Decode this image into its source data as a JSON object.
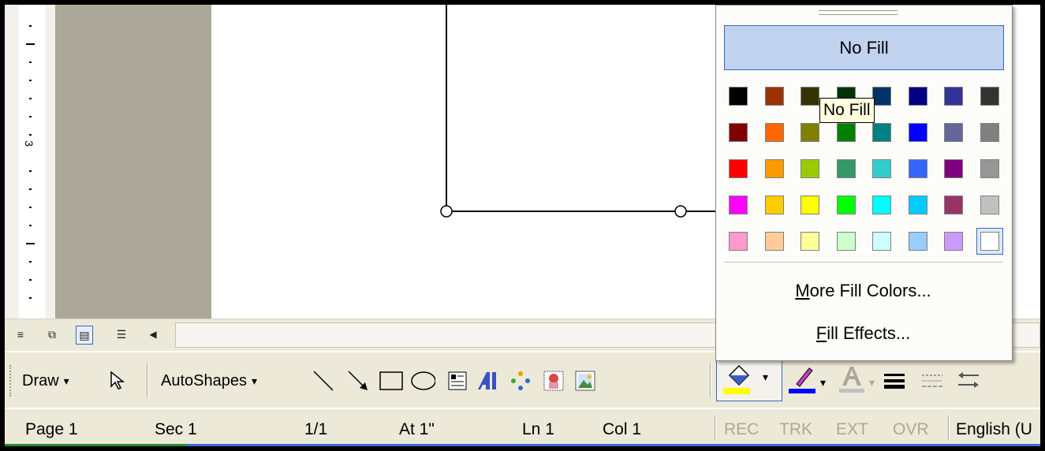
{
  "ruler": {
    "label": "3"
  },
  "viewbar": {
    "buttons": [
      {
        "name": "normal-view-button",
        "glyph": "≡"
      },
      {
        "name": "web-layout-view-button",
        "glyph": "⧉"
      },
      {
        "name": "print-layout-view-button",
        "glyph": "▤"
      },
      {
        "name": "outline-view-button",
        "glyph": "☰"
      },
      {
        "name": "scroll-left-button",
        "glyph": "◀"
      }
    ]
  },
  "drawing_toolbar": {
    "draw_label": "Draw",
    "autoshapes_label": "AutoShapes",
    "dropdown_glyph": "▾",
    "fill_color": "#ffff00",
    "line_color": "#0000ff",
    "font_color": "#c0c0c0",
    "icons": [
      "select-objects-icon",
      "line-icon",
      "arrow-icon",
      "rectangle-icon",
      "oval-icon",
      "text-box-icon",
      "wordart-icon",
      "diagram-icon",
      "clip-art-icon",
      "picture-icon",
      "fill-color-icon",
      "line-color-icon",
      "font-color-icon",
      "line-style-icon",
      "dash-style-icon",
      "arrow-style-icon"
    ]
  },
  "status": {
    "page": "Page 1",
    "sec": "Sec 1",
    "pages": "1/1",
    "at": "At 1\"",
    "ln": "Ln 1",
    "col": "Col 1",
    "rec": "REC",
    "trk": "TRK",
    "ext": "EXT",
    "ovr": "OVR",
    "language": "English (U"
  },
  "fill_popup": {
    "no_fill": "No Fill",
    "colors": [
      [
        "#000000",
        "#993300",
        "#333300",
        "#003300",
        "#003366",
        "#000080",
        "#333399",
        "#333333"
      ],
      [
        "#800000",
        "#ff6600",
        "#808000",
        "#008000",
        "#008080",
        "#0000ff",
        "#666699",
        "#808080"
      ],
      [
        "#ff0000",
        "#ff9900",
        "#99cc00",
        "#339966",
        "#33cccc",
        "#3366ff",
        "#800080",
        "#969696"
      ],
      [
        "#ff00ff",
        "#ffcc00",
        "#ffff00",
        "#00ff00",
        "#00ffff",
        "#00ccff",
        "#993366",
        "#c0c0c0"
      ],
      [
        "#ff99cc",
        "#ffcc99",
        "#ffff99",
        "#ccffcc",
        "#ccffff",
        "#99ccff",
        "#cc99ff",
        "#ffffff"
      ]
    ],
    "more_colors_prefix": "",
    "more_colors_key": "M",
    "more_colors_rest": "ore Fill Colors...",
    "fill_effects_key": "F",
    "fill_effects_rest": "ill Effects..."
  },
  "tooltip": "No Fill"
}
